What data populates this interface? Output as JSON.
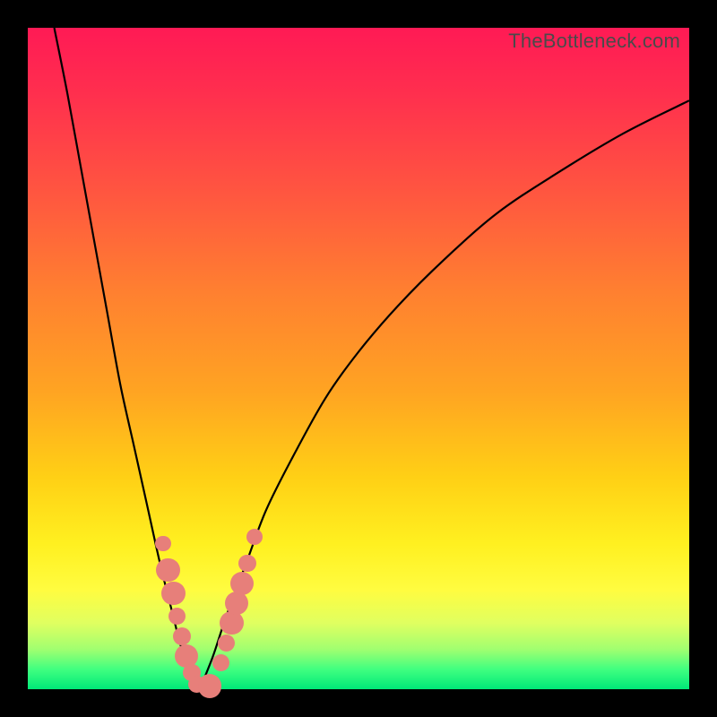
{
  "watermark": "TheBottleneck.com",
  "colors": {
    "frame": "#000000",
    "gradient_top": "#ff1a55",
    "gradient_mid": "#ffd015",
    "gradient_bottom": "#00e878",
    "curve": "#000000",
    "marker": "#e77f7a"
  },
  "chart_data": {
    "type": "line",
    "title": "",
    "xlabel": "",
    "ylabel": "",
    "xlim": [
      0,
      100
    ],
    "ylim": [
      0,
      100
    ],
    "grid": false,
    "series": [
      {
        "name": "left-branch",
        "x": [
          4,
          6,
          8,
          10,
          12,
          14,
          16,
          18,
          20,
          22,
          23,
          24,
          25,
          26
        ],
        "y": [
          100,
          90,
          79,
          68,
          57,
          46,
          37,
          28,
          19,
          11,
          7,
          4,
          2,
          0
        ]
      },
      {
        "name": "right-branch",
        "x": [
          26,
          28,
          30,
          33,
          36,
          40,
          45,
          50,
          56,
          63,
          71,
          80,
          90,
          100
        ],
        "y": [
          0,
          5,
          11,
          19,
          27,
          35,
          44,
          51,
          58,
          65,
          72,
          78,
          84,
          89
        ]
      }
    ],
    "markers": [
      {
        "x": 20.5,
        "y": 22,
        "r": 1.2
      },
      {
        "x": 21.2,
        "y": 18,
        "r": 1.8
      },
      {
        "x": 22.0,
        "y": 14.5,
        "r": 1.8
      },
      {
        "x": 22.6,
        "y": 11,
        "r": 1.3
      },
      {
        "x": 23.3,
        "y": 8,
        "r": 1.3
      },
      {
        "x": 24.0,
        "y": 5,
        "r": 1.8
      },
      {
        "x": 24.8,
        "y": 2.5,
        "r": 1.3
      },
      {
        "x": 25.5,
        "y": 0.8,
        "r": 1.3
      },
      {
        "x": 27.5,
        "y": 0.5,
        "r": 1.8
      },
      {
        "x": 29.2,
        "y": 4,
        "r": 1.3
      },
      {
        "x": 30.0,
        "y": 7,
        "r": 1.3
      },
      {
        "x": 30.8,
        "y": 10,
        "r": 1.8
      },
      {
        "x": 31.6,
        "y": 13,
        "r": 1.8
      },
      {
        "x": 32.4,
        "y": 16,
        "r": 1.8
      },
      {
        "x": 33.2,
        "y": 19,
        "r": 1.3
      },
      {
        "x": 34.3,
        "y": 23,
        "r": 1.2
      }
    ]
  }
}
